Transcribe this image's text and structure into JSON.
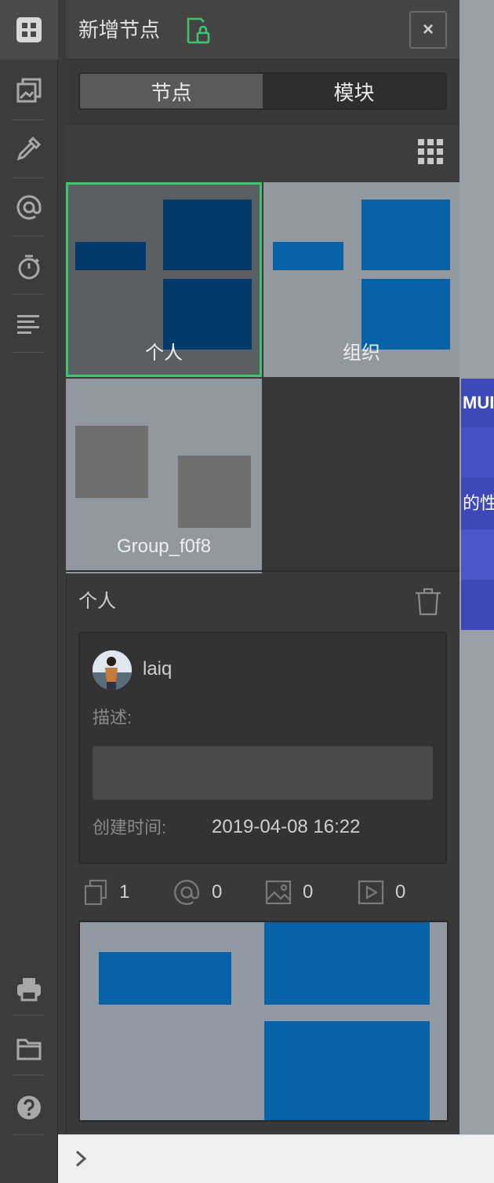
{
  "panel": {
    "title": "新增节点",
    "close_label": "×",
    "tabs": [
      {
        "label": "节点",
        "active": true
      },
      {
        "label": "模块",
        "active": false
      }
    ]
  },
  "templates": [
    {
      "label": "个人",
      "selected": true,
      "palette": "dark-blue"
    },
    {
      "label": "组织",
      "selected": false,
      "palette": "blue"
    },
    {
      "label": "Group_f0f8",
      "selected": false,
      "palette": "gray"
    }
  ],
  "details": {
    "section_title": "个人",
    "user": "laiq",
    "description_label": "描述:",
    "description_value": "",
    "created_label": "创建时间:",
    "created_value": "2019-04-08 16:22",
    "stats": [
      {
        "icon": "copy-icon",
        "count": "1"
      },
      {
        "icon": "at-icon",
        "count": "0"
      },
      {
        "icon": "image-icon",
        "count": "0"
      },
      {
        "icon": "play-icon",
        "count": "0"
      }
    ]
  },
  "background": {
    "text_1": "MUI",
    "text_2": "的性"
  },
  "toolbar": {
    "icons": [
      "layout-icon",
      "gallery-icon",
      "eyedropper-icon",
      "at-icon",
      "timer-icon",
      "align-left-icon",
      "print-icon",
      "folder-icon",
      "help-icon"
    ]
  },
  "colors": {
    "accent_green": "#3ec46d",
    "tile_dark_blue": "#043a6b",
    "tile_blue": "#0862a8",
    "tile_gray": "#6e6e6e",
    "tile_bg": "#9298a0",
    "banner_blue": "#3e48b8"
  }
}
